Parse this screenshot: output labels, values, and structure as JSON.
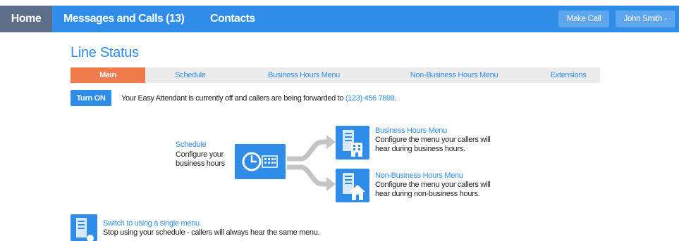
{
  "nav": {
    "home": "Home",
    "messages": "Messages and Calls (13)",
    "contacts": "Contacts",
    "make_call": "Make Call",
    "user": "John Smith -"
  },
  "page": {
    "title": "Line Status"
  },
  "tabs": [
    {
      "label": "Main",
      "active": true
    },
    {
      "label": "Schedule",
      "active": false
    },
    {
      "label": "Business Hours Menu",
      "active": false
    },
    {
      "label": "Non-Business Hours Menu",
      "active": false
    },
    {
      "label": "Extensions",
      "active": false
    }
  ],
  "status": {
    "button": "Turn ON",
    "text": "Your Easy Attendant is currently off and callers are being forwarded to",
    "phone": "(123) 456 7899",
    "suffix": "."
  },
  "schedule": {
    "link": "Schedule",
    "line1": "Configure your",
    "line2": "business hours"
  },
  "business_menu": {
    "link": "Business Hours Menu",
    "line1": "Configure the menu your callers will",
    "line2": "hear during business hours."
  },
  "non_business_menu": {
    "link": "Non-Business Hours Menu",
    "line1": "Configure the menu your callers will",
    "line2": "hear during non-business hours."
  },
  "single_menu": {
    "link": "Switch to using a single menu",
    "text": "Stop using your schedule - callers will always hear the same menu."
  },
  "colors": {
    "primary": "#2f8ce8",
    "home_bg": "#5d6f88",
    "active_tab": "#f07b4c",
    "tab_bar": "#ececec",
    "arrow_gray": "#c4c4c4"
  }
}
